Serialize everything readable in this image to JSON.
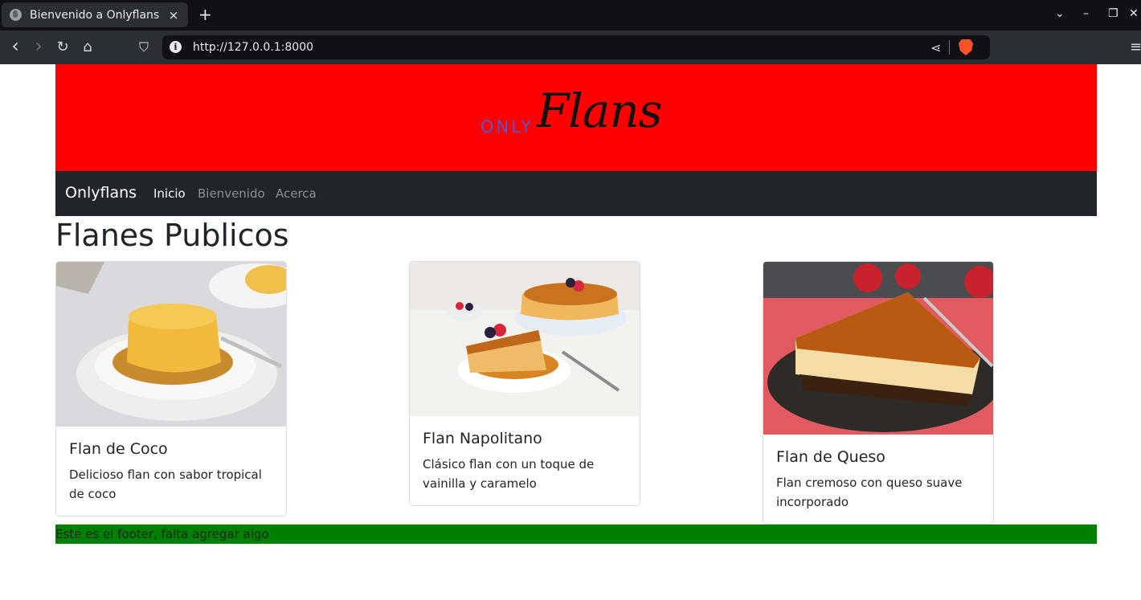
{
  "browser": {
    "tab_title": "Bienvenido a Onlyflans",
    "tab_close": "×",
    "new_tab": "+",
    "url": "http://127.0.0.1:8000",
    "back_icon": "‹",
    "forward_icon": "›",
    "reload_icon": "↻",
    "home_icon": "⌂",
    "bookmark_icon": "⛉",
    "share_icon": "⋖",
    "menu_icon": "≡",
    "minimize_icon": "–",
    "restore_icon": "❐",
    "close_icon": "✕",
    "tab_list_icon": "⌄"
  },
  "banner": {
    "logo_only": "ONLY",
    "logo_flans": "Flans",
    "background": "#ff0000"
  },
  "nav": {
    "brand": "Onlyflans",
    "links": [
      "Inicio",
      "Bienvenido",
      "Acerca"
    ]
  },
  "main": {
    "title": "Flanes Publicos",
    "cards": [
      {
        "title": "Flan de Coco",
        "text": "Delicioso flan con sabor tropical de coco"
      },
      {
        "title": "Flan Napolitano",
        "text": "Clásico flan con un toque de vainilla y caramelo"
      },
      {
        "title": "Flan de Queso",
        "text": "Flan cremoso con queso suave incorporado"
      }
    ]
  },
  "footer": {
    "text": "Este es el footer, falta agregar algo",
    "background": "#008000"
  }
}
